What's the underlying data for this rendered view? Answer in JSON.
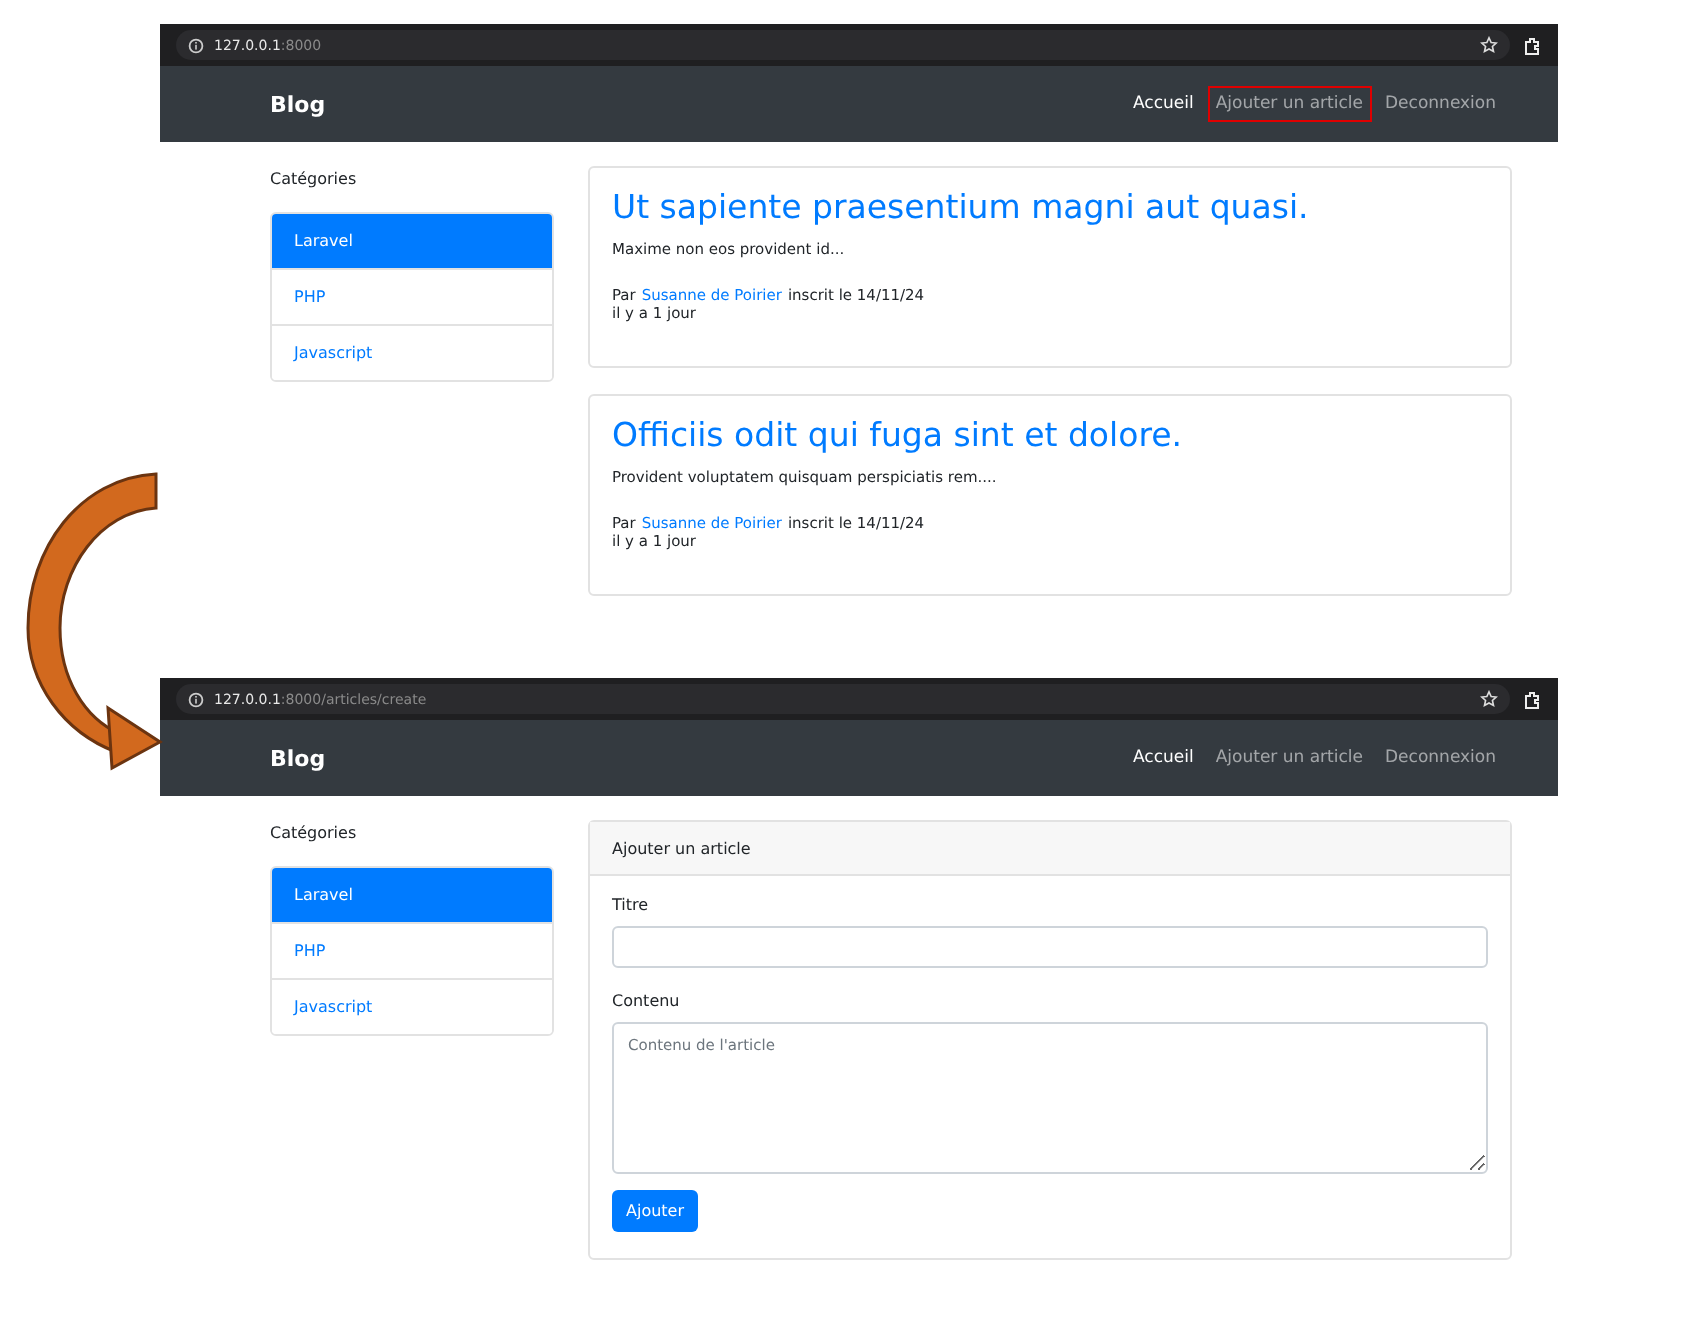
{
  "screens": [
    {
      "address": {
        "host": "127.0.0.1",
        "rest": ":8000"
      },
      "brand": "Blog",
      "nav": [
        {
          "label": "Accueil",
          "active": true,
          "highlighted": false
        },
        {
          "label": "Ajouter un article",
          "active": false,
          "highlighted": true
        },
        {
          "label": "Deconnexion",
          "active": false,
          "highlighted": false
        }
      ],
      "sidebar": {
        "title": "Catégories",
        "items": [
          {
            "label": "Laravel",
            "selected": true
          },
          {
            "label": "PHP",
            "selected": false
          },
          {
            "label": "Javascript",
            "selected": false
          }
        ]
      },
      "content": {
        "kind": "articles",
        "articles": [
          {
            "title": "Ut sapiente praesentium magni aut quasi.",
            "excerpt": "Maxime non eos provident id...",
            "prefix": "Par",
            "author": "Susanne de Poirier",
            "suffix": "inscrit le 14/11/24",
            "age": "il y a 1 jour"
          },
          {
            "title": "Officiis odit qui fuga sint et dolore.",
            "excerpt": "Provident voluptatem quisquam perspiciatis rem....",
            "prefix": "Par",
            "author": "Susanne de Poirier",
            "suffix": "inscrit le 14/11/24",
            "age": "il y a 1 jour"
          }
        ]
      }
    },
    {
      "address": {
        "host": "127.0.0.1",
        "rest": ":8000/articles/create"
      },
      "brand": "Blog",
      "nav": [
        {
          "label": "Accueil",
          "active": true,
          "highlighted": false
        },
        {
          "label": "Ajouter un article",
          "active": false,
          "highlighted": false
        },
        {
          "label": "Deconnexion",
          "active": false,
          "highlighted": false
        }
      ],
      "sidebar": {
        "title": "Catégories",
        "items": [
          {
            "label": "Laravel",
            "selected": true
          },
          {
            "label": "PHP",
            "selected": false
          },
          {
            "label": "Javascript",
            "selected": false
          }
        ]
      },
      "content": {
        "kind": "form",
        "header": "Ajouter un article",
        "fields": [
          {
            "label": "Titre",
            "kind": "input"
          },
          {
            "label": "Contenu",
            "kind": "textarea",
            "placeholder": "Contenu de l'article"
          }
        ],
        "button": "Ajouter"
      }
    }
  ]
}
